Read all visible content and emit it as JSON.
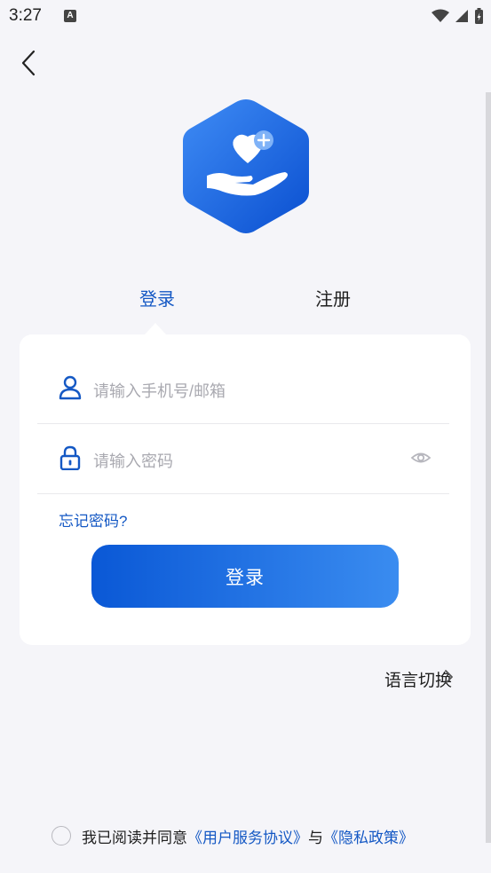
{
  "status_bar": {
    "time": "3:27",
    "notification_letter": "A"
  },
  "tabs": {
    "login": "登录",
    "register": "注册"
  },
  "form": {
    "account_placeholder": "请输入手机号/邮箱",
    "password_placeholder": "请输入密码",
    "forgot_password": "忘记密码?",
    "login_button": "登录"
  },
  "language_switch": "语言切换",
  "agreement": {
    "prefix": "我已阅读并同意",
    "user_agreement": "《用户服务协议》",
    "conjunction": "与",
    "privacy_policy": "《隐私政策》"
  },
  "colors": {
    "accent": "#1458c4",
    "button_start": "#0a58d6",
    "button_end": "#3a8cf0",
    "background": "#f5f5f9"
  },
  "icons": [
    "back-arrow-icon",
    "app-logo",
    "user-icon",
    "lock-icon",
    "eye-icon",
    "chevron-right-icon",
    "checkbox-circle"
  ]
}
